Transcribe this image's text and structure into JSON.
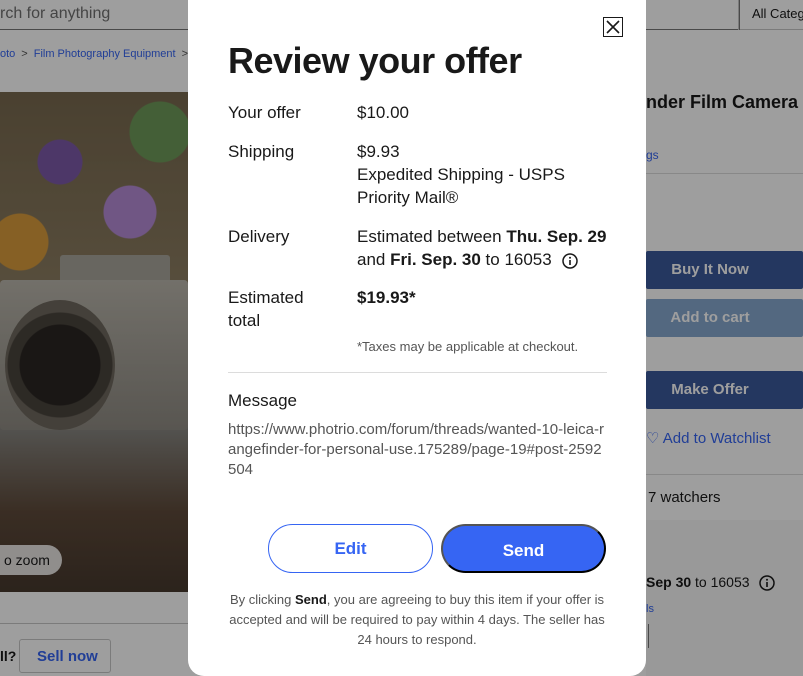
{
  "background": {
    "search_placeholder": "rch for anything",
    "category_label": "All Categ",
    "breadcrumbs": [
      "oto",
      "Film Photography Equipment"
    ],
    "zoom_label": "o zoom",
    "sell_question": "ll?",
    "sell_button": "Sell now",
    "product_title_fragment": "nder Film Camera",
    "ratings_link_fragment": "gs",
    "buy_now": "Buy It Now",
    "add_to_cart": "Add to cart",
    "make_offer": "Make Offer",
    "add_to_watchlist": "Add to Watchlist",
    "watchers": "7 watchers",
    "delivery_fragment_bold": "Sep 30",
    "delivery_fragment_rest": "to 16053",
    "details_link": "ls"
  },
  "modal": {
    "title": "Review your offer",
    "your_offer_label": "Your offer",
    "your_offer_value": "$10.00",
    "shipping_label": "Shipping",
    "shipping_cost": "$9.93",
    "shipping_method": "Expedited Shipping - USPS Priority Mail®",
    "delivery_label": "Delivery",
    "delivery_prefix": "Estimated between",
    "delivery_start": "Thu. Sep. 29",
    "delivery_and": "and",
    "delivery_end": "Fri. Sep. 30",
    "delivery_to": "to 16053",
    "estimated_total_label": "Estimated total",
    "estimated_total_value": "$19.93*",
    "tax_note": "*Taxes may be applicable at checkout.",
    "message_label": "Message",
    "message_text": "https://www.photrio.com/forum/threads/wanted-10-leica-rangefinder-for-personal-use.175289/page-19#post-2592504",
    "edit_button": "Edit",
    "send_button": "Send",
    "legal_prefix": "By clicking",
    "legal_bold": "Send",
    "legal_rest": ", you are agreeing to buy this item if your offer is accepted and will be required to pay within 4 days. The seller has 24 hours to respond."
  },
  "colors": {
    "accent": "#3665f3",
    "overlay": "rgba(0,0,0,0.38)"
  }
}
